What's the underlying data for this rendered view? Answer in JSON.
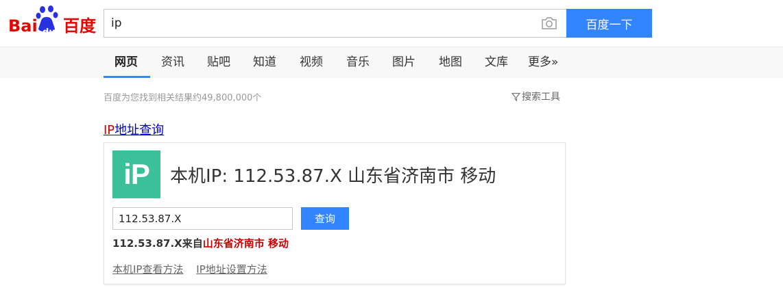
{
  "logo": {
    "part1": "Bai",
    "part2": "du",
    "part3": "百度",
    "accent_red": "#e10601",
    "accent_blue": "#2932e1"
  },
  "search": {
    "query": "ip",
    "button_label": "百度一下",
    "camera_icon": "camera-icon"
  },
  "nav": {
    "items": [
      {
        "label": "网页",
        "active": true
      },
      {
        "label": "资讯"
      },
      {
        "label": "贴吧"
      },
      {
        "label": "知道"
      },
      {
        "label": "视频"
      },
      {
        "label": "音乐"
      },
      {
        "label": "图片"
      },
      {
        "label": "地图"
      },
      {
        "label": "文库"
      },
      {
        "label": "更多»"
      }
    ]
  },
  "results": {
    "count_text": "百度为您找到相关结果约49,800,000个",
    "tools_label": "搜索工具",
    "first": {
      "title_highlight": "IP",
      "title_rest": "地址查询",
      "logo_text": "iP",
      "headline": "本机IP: 112.53.87.X  山东省济南市 移动",
      "input_value": "112.53.87.X",
      "query_button": "查询",
      "result_ip": "112.53.87.X来自",
      "result_location": "山东省济南市 移动",
      "link1": "本机IP查看方法",
      "link2": "IP地址设置方法"
    }
  },
  "colors": {
    "primary_button": "#3385ff",
    "ip_logo_bg": "#3cc09a"
  }
}
